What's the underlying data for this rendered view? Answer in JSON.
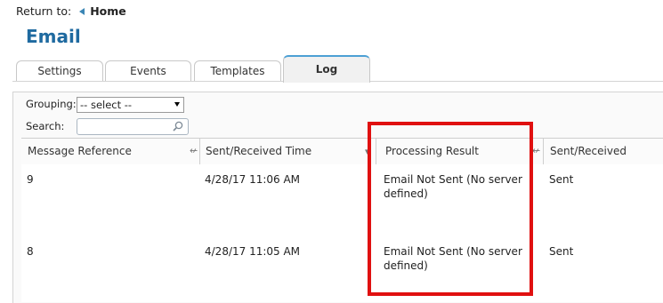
{
  "return_bar": {
    "label": "Return to:",
    "link": "Home",
    "icon": "back-arrow-icon"
  },
  "page_title": "Email",
  "tabs": [
    {
      "label": "Settings",
      "active": false
    },
    {
      "label": "Events",
      "active": false
    },
    {
      "label": "Templates",
      "active": false
    },
    {
      "label": "Log",
      "active": true
    }
  ],
  "filters": {
    "grouping_label": "Grouping:",
    "grouping_value": "-- select --",
    "search_label": "Search:",
    "search_value": ""
  },
  "table": {
    "columns": [
      {
        "label": "Message Reference",
        "icon": "column-resize-icon"
      },
      {
        "label": "Sent/Received Time",
        "icon": "sort-desc-icon"
      },
      {
        "label": "Processing Result",
        "icon": "column-resize-icon"
      },
      {
        "label": "Sent/Received"
      }
    ],
    "rows": [
      {
        "reference": "9",
        "time": "4/28/17 11:06 AM",
        "result": "Email Not Sent (No server defined)",
        "direction": "Sent"
      },
      {
        "reference": "8",
        "time": "4/28/17 11:05 AM",
        "result": "Email Not Sent (No server defined)",
        "direction": "Sent"
      }
    ]
  },
  "colors": {
    "title": "#1f6aa0",
    "active_tab_accent": "#4ca0d4",
    "highlight_box": "#e01010"
  }
}
